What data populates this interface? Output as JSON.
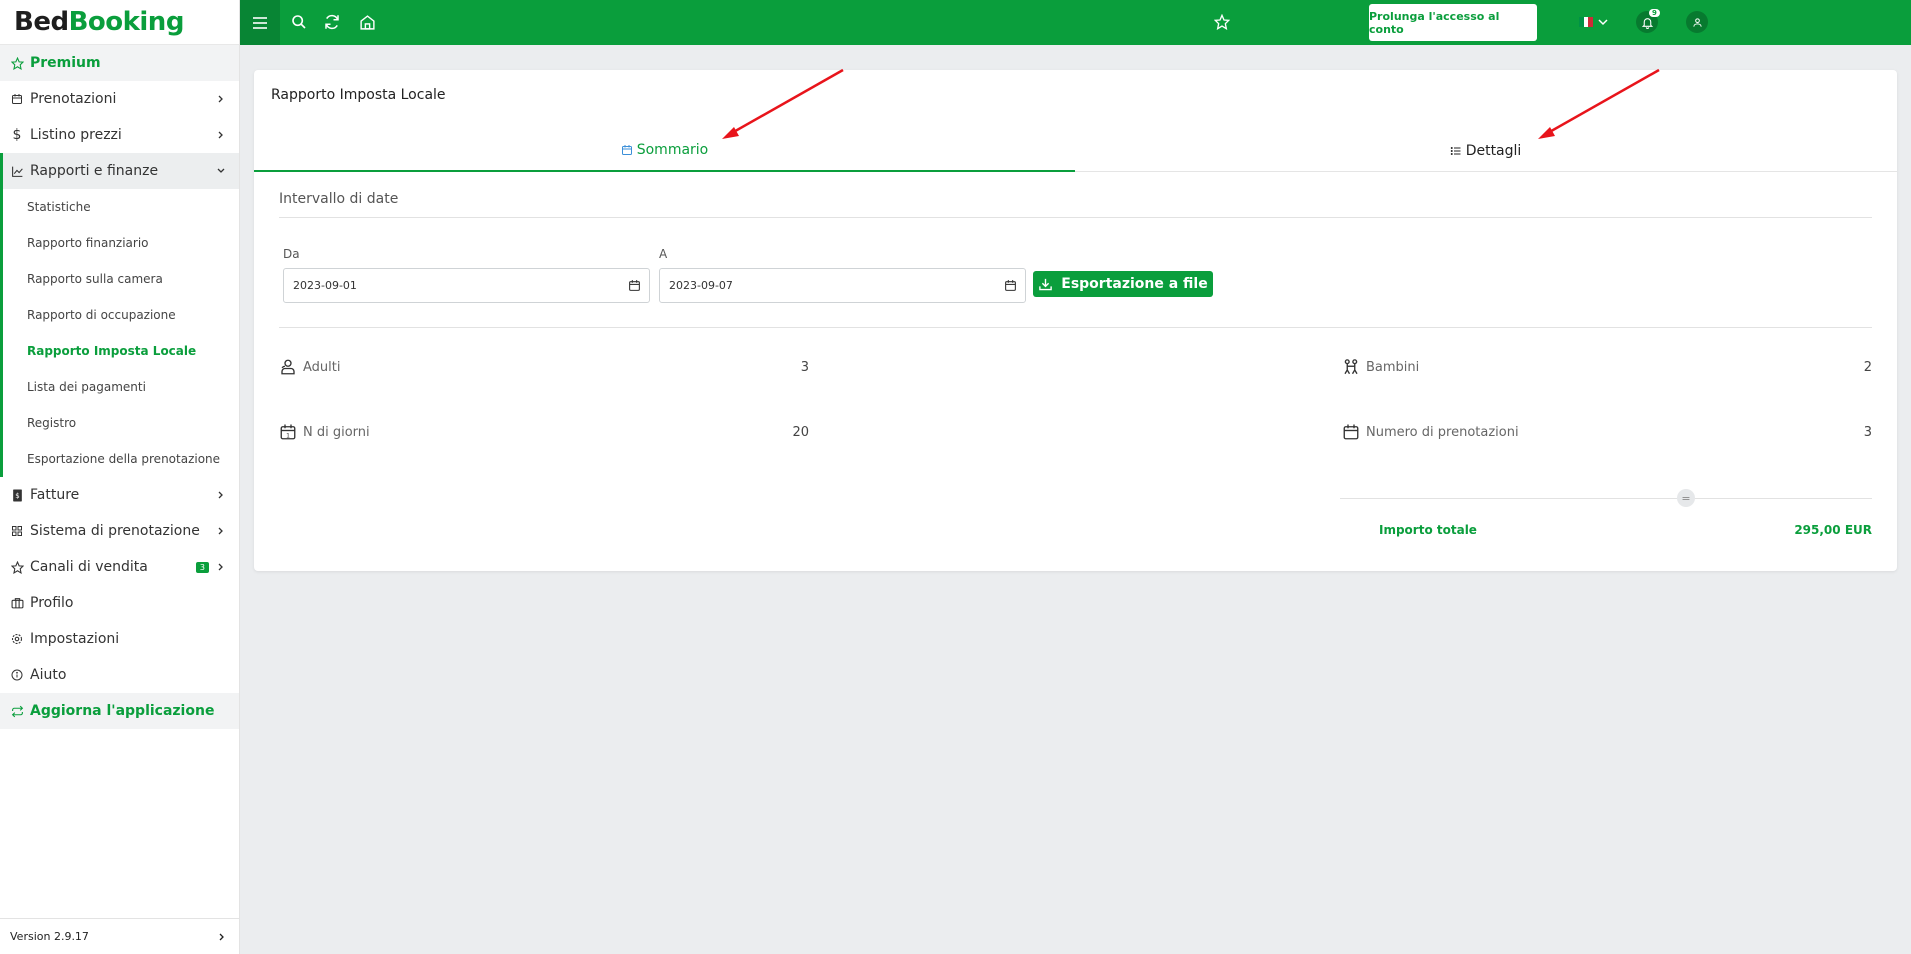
{
  "brand": {
    "part1": "Bed",
    "part2": "Booking",
    "color": "#0a9e3c"
  },
  "sidebar": {
    "items": [
      {
        "label": "Premium",
        "icon": "star-icon"
      },
      {
        "label": "Prenotazioni",
        "icon": "calendar-icon"
      },
      {
        "label": "Listino prezzi",
        "icon": "dollar-icon"
      },
      {
        "label": "Rapporti e finanze",
        "icon": "chart-icon"
      }
    ],
    "subitems": [
      "Statistiche",
      "Rapporto finanziario",
      "Rapporto sulla camera",
      "Rapporto di occupazione",
      "Rapporto Imposta Locale",
      "Lista dei pagamenti",
      "Registro",
      "Esportazione della prenotazione"
    ],
    "items2": [
      {
        "label": "Fatture",
        "icon": "invoice-icon"
      },
      {
        "label": "Sistema di prenotazione",
        "icon": "grid-icon"
      },
      {
        "label": "Canali di vendita",
        "icon": "star-icon",
        "badge": "3"
      },
      {
        "label": "Profilo",
        "icon": "briefcase-icon"
      },
      {
        "label": "Impostazioni",
        "icon": "gear-icon"
      },
      {
        "label": "Aiuto",
        "icon": "info-icon"
      },
      {
        "label": "Aggiorna l'applicazione",
        "icon": "refresh-icon"
      }
    ],
    "version": "Version 2.9.17"
  },
  "topbar": {
    "prolunga_label": "Prolunga l'accesso al conto",
    "notifications_count": "9"
  },
  "card": {
    "title": "Rapporto Imposta Locale",
    "tabs": [
      {
        "label": "Sommario",
        "icon": "calendar-icon"
      },
      {
        "label": "Dettagli",
        "icon": "list-icon"
      }
    ],
    "section_title": "Intervallo di date",
    "from_label": "Da",
    "from_value": "2023-09-01",
    "to_label": "A",
    "to_value": "2023-09-07",
    "export_label": "Esportazione a file",
    "stats": [
      {
        "label": "Adulti",
        "value": "3",
        "icon": "adults-icon"
      },
      {
        "label": "Bambini",
        "value": "2",
        "icon": "children-icon"
      },
      {
        "label": "N di giorni",
        "value": "20",
        "icon": "calendar-day-icon"
      },
      {
        "label": "Numero di prenotazioni",
        "value": "3",
        "icon": "calendar-icon"
      }
    ],
    "equals_sign": "=",
    "total_label": "Importo totale",
    "total_value": "295,00 EUR"
  }
}
